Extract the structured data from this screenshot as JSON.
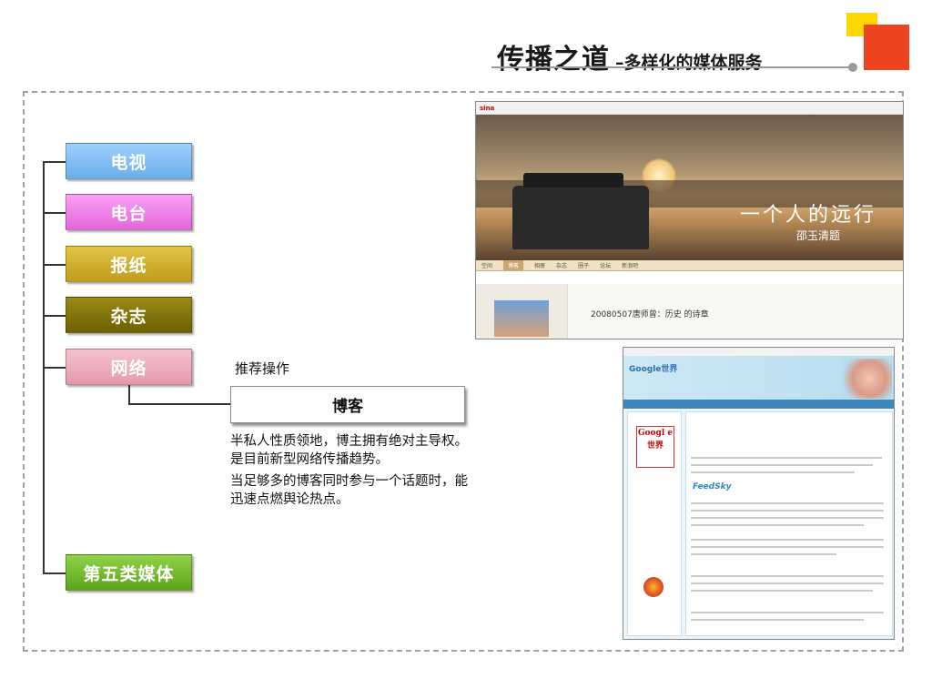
{
  "header": {
    "title": "传播之道",
    "subtitle": "–多样化的媒体服务"
  },
  "categories": [
    {
      "label": "电视"
    },
    {
      "label": "电台"
    },
    {
      "label": "报纸"
    },
    {
      "label": "杂志"
    },
    {
      "label": "网络"
    },
    {
      "label": "第五类媒体"
    }
  ],
  "network": {
    "recommend_label": "推荐操作",
    "blog_label": "博客",
    "description": [
      "半私人性质领地，博主拥有绝对主导权。是目前新型网络传播趋势。",
      "当足够多的博客同时参与一个话题时，能迅速点燃舆论热点。"
    ]
  },
  "screenshots": {
    "blog": {
      "banner_title": "一个人的远行",
      "signature": "邵玉清题",
      "post_title": "20080507唐师曾：历史 的诗章",
      "tabs": [
        "空间",
        "博客",
        "相册",
        "杂志",
        "圈子",
        "论坛",
        "新浪吧"
      ]
    },
    "google": {
      "brand": "Google世界",
      "logo_text": "Googl e 世界",
      "feed_label": "FeedSky"
    }
  },
  "colors": {
    "tv": "#7ab8f0",
    "radio": "#ee7ee8",
    "paper": "#d0b030",
    "magazine": "#857400",
    "network": "#eeb0c0",
    "fifth": "#78c030",
    "deco_yellow": "#ffd700",
    "deco_red": "#ee4422"
  }
}
